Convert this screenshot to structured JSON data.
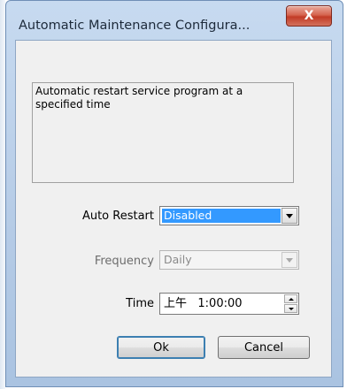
{
  "window": {
    "title": "Automatic Maintenance Configura..."
  },
  "titlebar": {
    "close_glyph": "X",
    "close_icon": "close-icon"
  },
  "description": "Automatic restart service program at a specified time",
  "auto_restart": {
    "label": "Auto Restart",
    "value": "Disabled"
  },
  "frequency": {
    "label": "Frequency",
    "value": "Daily"
  },
  "time": {
    "label": "Time",
    "value": "上午   1:00:00"
  },
  "buttons": {
    "ok": "Ok",
    "cancel": "Cancel"
  },
  "colors": {
    "selection": "#3399ff",
    "close_button": "#c23b26",
    "titlebar": "#b5cbe6"
  }
}
